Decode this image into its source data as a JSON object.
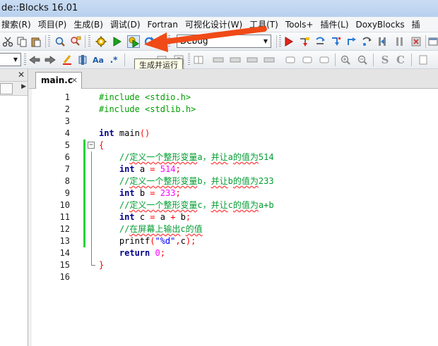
{
  "window": {
    "title": "de::Blocks 16.01"
  },
  "menu": [
    "搜索(R)",
    "项目(P)",
    "生成(B)",
    "调试(D)",
    "Fortran",
    "可视化设计(W)",
    "工具(T)",
    "Tools+",
    "插件(L)",
    "DoxyBlocks",
    "插"
  ],
  "toolbar": {
    "build_target_value": "Debug",
    "tooltip": "生成并运行"
  },
  "colors": {
    "annotation_arrow": "#f04a17",
    "changebar": "#22d33a"
  },
  "editor": {
    "tab_label": "main.c",
    "tab_close": "×",
    "lines": [
      {
        "n": "1",
        "code": "#include <stdio.h>"
      },
      {
        "n": "2",
        "code": "#include <stdlib.h>"
      },
      {
        "n": "3",
        "code": ""
      },
      {
        "n": "4",
        "code": "int main()"
      },
      {
        "n": "5",
        "code": "{"
      },
      {
        "n": "6",
        "code": "    //定义一个整形变量a，并让a的值为514"
      },
      {
        "n": "7",
        "code": "    int a = 514;"
      },
      {
        "n": "8",
        "code": "    //定义一个整形变量b，并让b的值为233"
      },
      {
        "n": "9",
        "code": "    int b = 233;"
      },
      {
        "n": "10",
        "code": "    //定义一个整形变量c，并让c的值为a+b"
      },
      {
        "n": "11",
        "code": "    int c = a + b;"
      },
      {
        "n": "12",
        "code": "    //在屏幕上输出c的值"
      },
      {
        "n": "13",
        "code": "    printf(\"%d\",c);"
      },
      {
        "n": "14",
        "code": "    return 0;"
      },
      {
        "n": "15",
        "code": "}"
      },
      {
        "n": "16",
        "code": ""
      }
    ]
  },
  "icons": {
    "toolbar1": [
      "cut-icon",
      "copy-icon",
      "paste-icon",
      "find-icon",
      "replace-icon",
      "build-icon",
      "run-icon",
      "build-and-run-icon",
      "rebuild-icon",
      "debug-icon",
      "debug-run-to-cursor-icon",
      "debug-next-line-icon",
      "debug-step-into-icon",
      "debug-step-out-icon",
      "debug-next-instruction-icon",
      "debug-pause-icon",
      "debug-stop-icon"
    ],
    "toolbar2": [
      "back-icon",
      "forward-icon",
      "highlight-icon",
      "toggle-bookmark-icon",
      "match-case-icon",
      "regex-icon",
      "zoom-in-icon",
      "zoom-out-icon",
      "spell-check-icon",
      "code-completion-icon"
    ]
  }
}
